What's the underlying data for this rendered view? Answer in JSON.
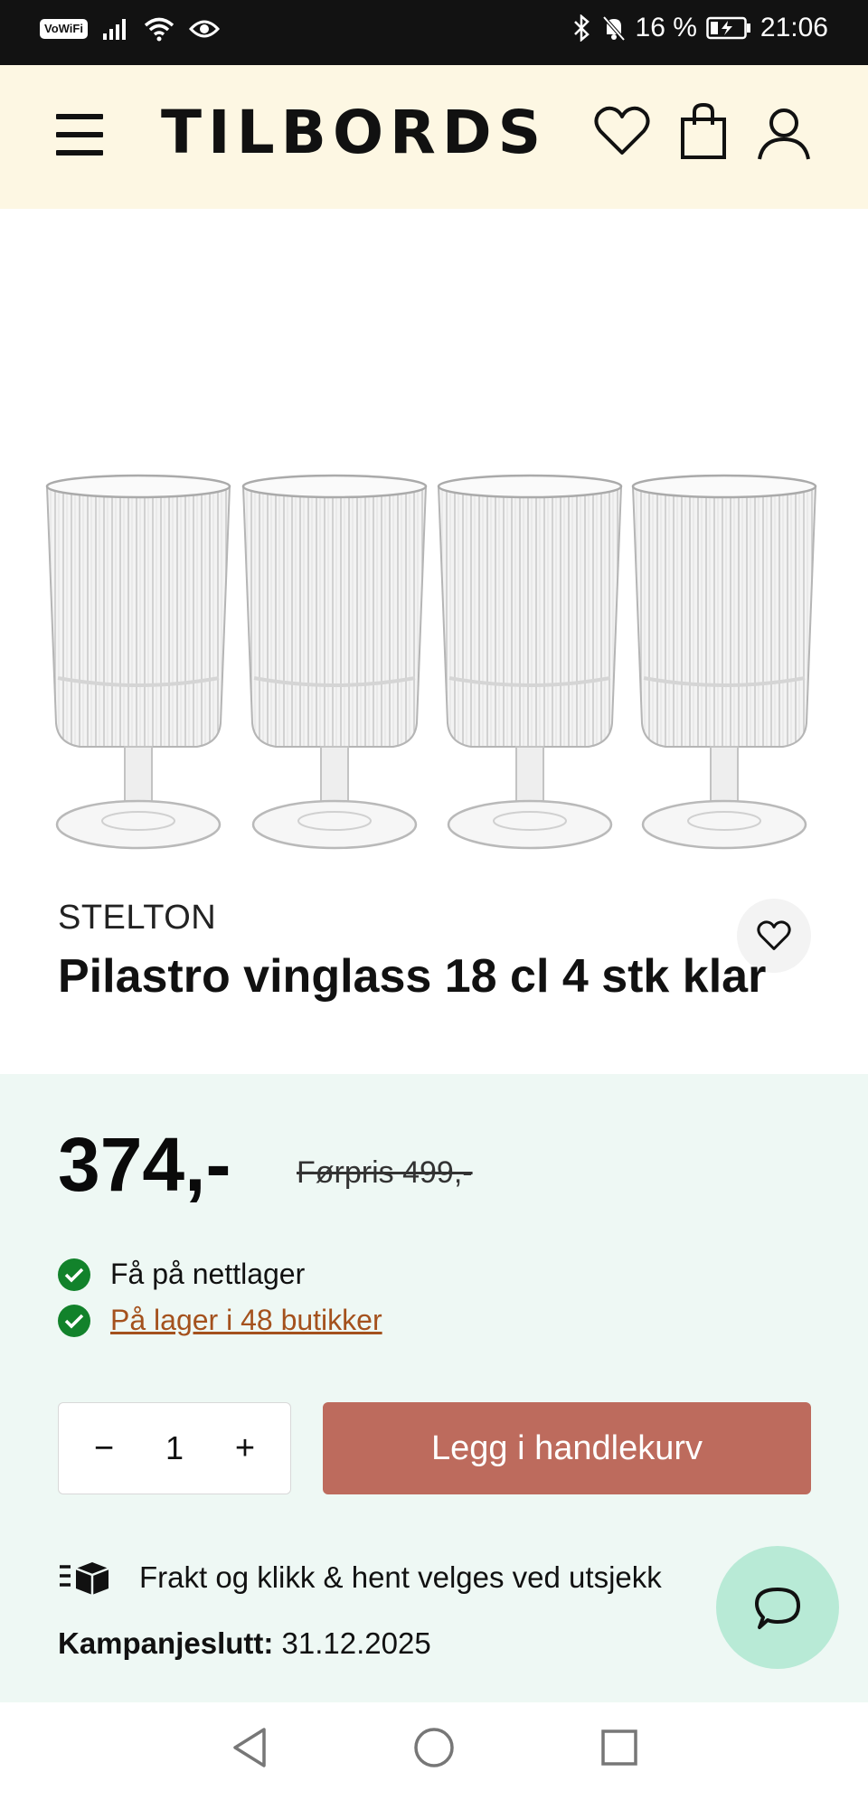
{
  "status_bar": {
    "vowifi": "VoWiFi",
    "battery": "16 %",
    "time": "21:06"
  },
  "header": {
    "logo": "TILBORDS",
    "icons": [
      "menu-icon",
      "heart-icon",
      "shopping-bag-icon",
      "user-icon"
    ]
  },
  "product": {
    "brand": "STELTON",
    "title": "Pilastro vinglass 18 cl 4 stk klar",
    "price": "374,-",
    "old_price": "Førpris 499,-",
    "stock_online": "Få på nettlager",
    "stock_stores": "På lager i 48 butikker",
    "quantity": "1",
    "minus": "−",
    "plus": "+",
    "add_to_cart": "Legg i handlekurv",
    "shipping": "Frakt og klikk & hent velges ved utsjekk",
    "campaign_label": "Kampanjeslutt:",
    "campaign_date": "31.12.2025"
  },
  "colors": {
    "header_bg": "#fdf7e3",
    "panel_bg": "#eef8f4",
    "cart_button": "#bd6b5d",
    "check": "#12822b",
    "link": "#a4511d",
    "chat_bg": "#b8ead6"
  }
}
